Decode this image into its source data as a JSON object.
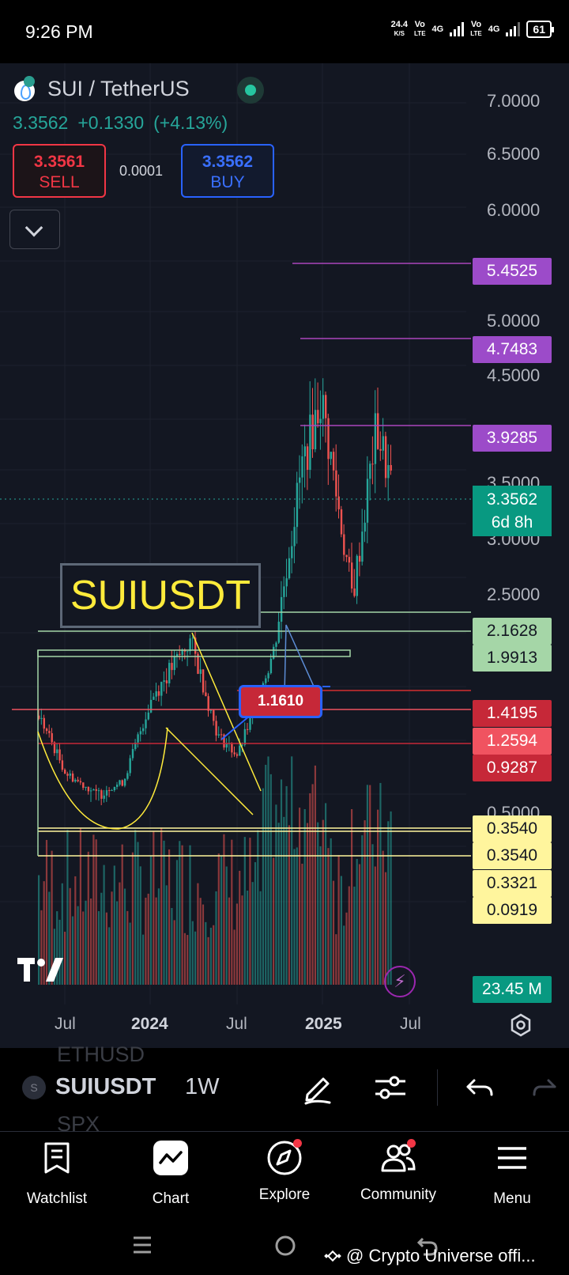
{
  "status_bar": {
    "time": "9:26 PM",
    "speed_value": "24.4",
    "speed_unit": "K/S",
    "net1": "Vo",
    "net1_sub": "LTE",
    "net2": "4G",
    "net3": "Vo",
    "net3_sub": "LTE",
    "net4": "4G",
    "battery": "61"
  },
  "header": {
    "symbol_title": "SUI / TetherUS",
    "last_price": "3.3562",
    "change_abs": "+0.1330",
    "change_pct": "(+4.13%)",
    "sell_price": "3.3561",
    "sell_label": "SELL",
    "spread": "0.0001",
    "buy_price": "3.3562",
    "buy_label": "BUY"
  },
  "price_axis": {
    "ticks": [
      "7.0000",
      "6.5000",
      "6.0000",
      "5.0000",
      "4.5000",
      "3.5000",
      "3.0000",
      "2.5000",
      "0.5000"
    ],
    "current_price": "3.3562",
    "countdown": "6d 8h",
    "level_tags": [
      {
        "value": "5.4525",
        "color": "#9c4bc9"
      },
      {
        "value": "4.7483",
        "color": "#9c4bc9"
      },
      {
        "value": "3.9285",
        "color": "#9c4bc9"
      },
      {
        "value": "2.1628",
        "color": "#a5d6a7"
      },
      {
        "value": "1.9913",
        "color": "#a5d6a7"
      },
      {
        "value": "1.4195",
        "color": "#c62838"
      },
      {
        "value": "1.2594",
        "color": "#f05360"
      },
      {
        "value": "0.9287",
        "color": "#c62838"
      },
      {
        "value": "0.3540",
        "color": "#fff59d"
      },
      {
        "value": "0.3540",
        "color": "#fff59d"
      },
      {
        "value": "0.3321",
        "color": "#fff59d"
      },
      {
        "value": "0.0919",
        "color": "#fff59d"
      }
    ],
    "volume_tag": "23.45 M"
  },
  "time_axis": {
    "labels": [
      "Jul",
      "2024",
      "Jul",
      "2025",
      "Jul"
    ]
  },
  "annotations": {
    "symbol_box": "SUIUSDT",
    "callout": "1.1610"
  },
  "chart_data": {
    "type": "candlestick",
    "symbol": "SUIUSDT",
    "interval": "1W",
    "x": [
      "2023-05",
      "2023-07",
      "2023-09",
      "2023-11",
      "2024-01",
      "2024-03",
      "2024-05",
      "2024-07",
      "2024-09",
      "2024-11",
      "2025-01",
      "2025-03",
      "2025-05",
      "2025-06"
    ],
    "close": [
      1.2,
      0.66,
      0.48,
      0.58,
      1.35,
      1.9,
      1.0,
      0.82,
      1.8,
      3.5,
      4.2,
      2.3,
      3.9,
      3.3562
    ],
    "ylim": [
      0.3,
      7.0
    ],
    "levels": [
      5.4525,
      4.7483,
      3.9285,
      2.1628,
      1.9913,
      1.4195,
      1.2594,
      0.9287,
      0.354,
      0.3321,
      0.0919
    ],
    "grid": true
  },
  "toolbar": {
    "ghost_top": "ETHUSD",
    "symbol": "SUIUSDT",
    "interval": "1W",
    "ghost_bottom": "SPX"
  },
  "bottom_nav": {
    "items": [
      "Watchlist",
      "Chart",
      "Explore",
      "Community",
      "Menu"
    ]
  },
  "watermark": "@ Crypto Universe offi..."
}
